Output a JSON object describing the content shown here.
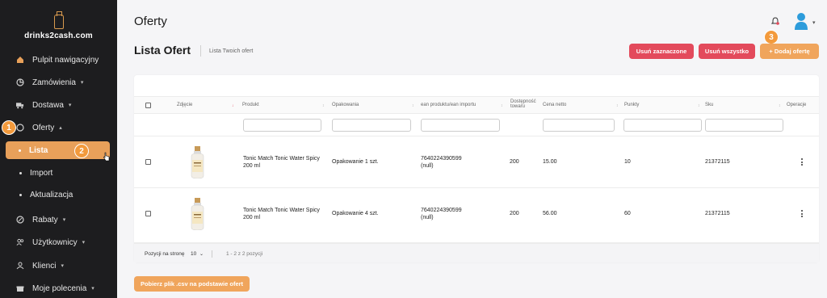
{
  "brand": {
    "name": "drinks2cash.com"
  },
  "sidebar": {
    "items": [
      {
        "label": "Pulpit nawigacyjny",
        "icon": "home-icon"
      },
      {
        "label": "Zamówienia",
        "icon": "orders-icon"
      },
      {
        "label": "Dostawa",
        "icon": "truck-icon"
      },
      {
        "label": "Oferty",
        "icon": "offers-icon"
      },
      {
        "label": "Rabaty",
        "icon": "discount-icon"
      },
      {
        "label": "Użytkownicy",
        "icon": "users-icon"
      },
      {
        "label": "Klienci",
        "icon": "client-icon"
      },
      {
        "label": "Moje polecenia",
        "icon": "gift-icon"
      }
    ],
    "subitems": [
      {
        "label": "Lista",
        "active": true
      },
      {
        "label": "Import"
      },
      {
        "label": "Aktualizacja"
      }
    ]
  },
  "badges": [
    "1",
    "2",
    "3"
  ],
  "header": {
    "title": "Oferty"
  },
  "page": {
    "title": "Lista Ofert",
    "subtitle": "Lista Twoich ofert",
    "btn_delete_selected": "Usuń zaznaczone",
    "btn_delete_all": "Usuń wszystko",
    "btn_add": "+ Dodaj ofertę",
    "btn_csv": "Pobierz plik .csv na podstawie ofert"
  },
  "table": {
    "columns": [
      "Zdjęcie",
      "Produkt",
      "Opakowania",
      "ean produktu/ean importu",
      "Dostępność towaru",
      "Cena netto",
      "Punkty",
      "Sku",
      "Operacje"
    ],
    "rows": [
      {
        "product": "Tonic Match Tonic Water Spicy 200 ml",
        "packaging": "Opakowanie 1 szt.",
        "ean": "7640224390599",
        "ean2": "(null)",
        "stock": "200",
        "price": "15.00",
        "points": "10",
        "sku": "21372115"
      },
      {
        "product": "Tonic Match Tonic Water Spicy 200 ml",
        "packaging": "Opakowanie 4 szt.",
        "ean": "7640224390599",
        "ean2": "(null)",
        "stock": "200",
        "price": "56.00",
        "points": "60",
        "sku": "21372115"
      }
    ],
    "footer": {
      "per_page_label": "Pozycji na stronę",
      "per_page_value": "10",
      "range": "1 - 2 z 2 pozycji"
    }
  },
  "colors": {
    "accent": "#f0a55c",
    "danger": "#e34a5c",
    "sidebar_bg": "#1d1d1f"
  }
}
